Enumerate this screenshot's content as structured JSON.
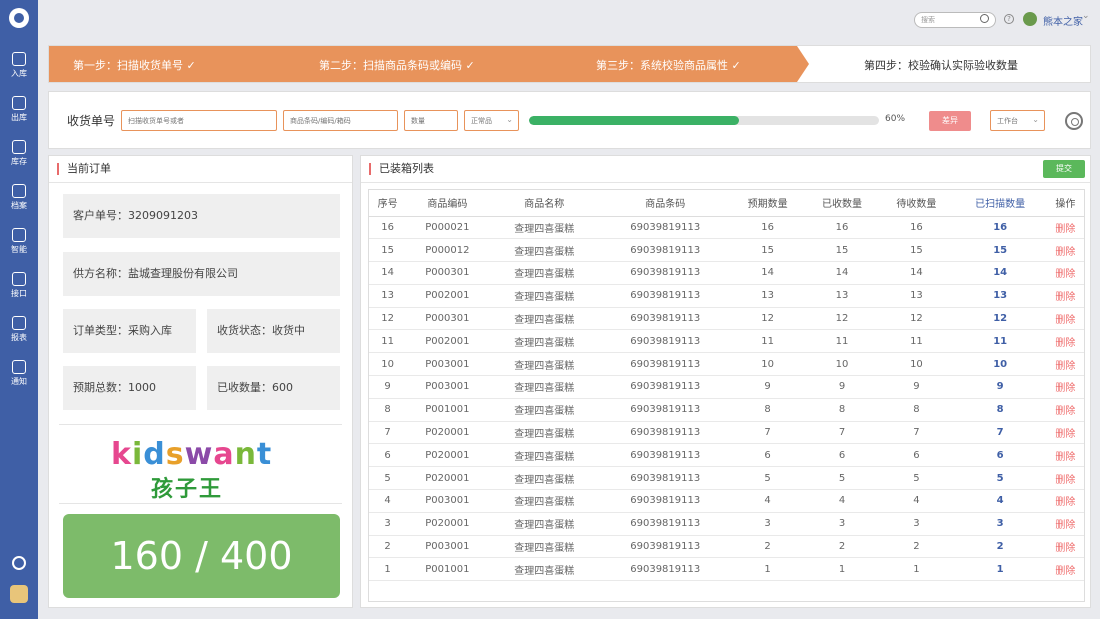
{
  "sidebar": {
    "items": [
      {
        "label": "入库",
        "icon": "home-icon"
      },
      {
        "label": "出库",
        "icon": "export-icon"
      },
      {
        "label": "库存",
        "icon": "warehouse-icon"
      },
      {
        "label": "档案",
        "icon": "archive-icon"
      },
      {
        "label": "智能",
        "icon": "smart-icon"
      },
      {
        "label": "接口",
        "icon": "api-icon"
      },
      {
        "label": "报表",
        "icon": "report-icon"
      },
      {
        "label": "通知",
        "icon": "bell-icon"
      }
    ]
  },
  "topbar": {
    "search_placeholder": "搜索",
    "user_name": "熊本之家"
  },
  "steps": {
    "step1": "第一步：扫描收货单号 ✓",
    "step2": "第二步：扫描商品条码或编码 ✓",
    "step3": "第三步：系统校验商品属性 ✓",
    "step4": "第四步：校验确认实际验收数量"
  },
  "inputbar": {
    "label": "收货单号",
    "order_placeholder": "扫描收货单号或者",
    "barcode_placeholder": "商品条码/编码/箱码",
    "qty_placeholder": "数量",
    "quality_value": "正常品",
    "progress_percent": 60,
    "progress_text": "60%",
    "diff_button": "差异",
    "station_value": "工作台"
  },
  "left_panel": {
    "title": "当前订单",
    "customer_no": "客户单号：3209091203",
    "supplier": "供方名称：盐城查理股份有限公司",
    "order_type": "订单类型：采购入库",
    "receive_status": "收货状态：收货中",
    "expected_total": "预期总数：1000",
    "received_qty": "已收数量：600",
    "logo_text_en": "kidswant",
    "logo_text_cn": "孩子王",
    "counter": "160 / 400"
  },
  "right_panel": {
    "title": "已装箱列表",
    "submit_button": "提交",
    "headers": [
      "序号",
      "商品编码",
      "商品名称",
      "商品条码",
      "预期数量",
      "已收数量",
      "待收数量",
      "已扫描数量",
      "操作"
    ],
    "rows": [
      [
        "16",
        "P000021",
        "查理四喜蛋糕",
        "69039819113",
        "16",
        "16",
        "16",
        "16",
        "删除"
      ],
      [
        "15",
        "P000012",
        "查理四喜蛋糕",
        "69039819113",
        "15",
        "15",
        "15",
        "15",
        "删除"
      ],
      [
        "14",
        "P000301",
        "查理四喜蛋糕",
        "69039819113",
        "14",
        "14",
        "14",
        "14",
        "删除"
      ],
      [
        "13",
        "P002001",
        "查理四喜蛋糕",
        "69039819113",
        "13",
        "13",
        "13",
        "13",
        "删除"
      ],
      [
        "12",
        "P000301",
        "查理四喜蛋糕",
        "69039819113",
        "12",
        "12",
        "12",
        "12",
        "删除"
      ],
      [
        "11",
        "P002001",
        "查理四喜蛋糕",
        "69039819113",
        "11",
        "11",
        "11",
        "11",
        "删除"
      ],
      [
        "10",
        "P003001",
        "查理四喜蛋糕",
        "69039819113",
        "10",
        "10",
        "10",
        "10",
        "删除"
      ],
      [
        "9",
        "P003001",
        "查理四喜蛋糕",
        "69039819113",
        "9",
        "9",
        "9",
        "9",
        "删除"
      ],
      [
        "8",
        "P001001",
        "查理四喜蛋糕",
        "69039819113",
        "8",
        "8",
        "8",
        "8",
        "删除"
      ],
      [
        "7",
        "P020001",
        "查理四喜蛋糕",
        "69039819113",
        "7",
        "7",
        "7",
        "7",
        "删除"
      ],
      [
        "6",
        "P020001",
        "查理四喜蛋糕",
        "69039819113",
        "6",
        "6",
        "6",
        "6",
        "删除"
      ],
      [
        "5",
        "P020001",
        "查理四喜蛋糕",
        "69039819113",
        "5",
        "5",
        "5",
        "5",
        "删除"
      ],
      [
        "4",
        "P003001",
        "查理四喜蛋糕",
        "69039819113",
        "4",
        "4",
        "4",
        "4",
        "删除"
      ],
      [
        "3",
        "P020001",
        "查理四喜蛋糕",
        "69039819113",
        "3",
        "3",
        "3",
        "3",
        "删除"
      ],
      [
        "2",
        "P003001",
        "查理四喜蛋糕",
        "69039819113",
        "2",
        "2",
        "2",
        "2",
        "删除"
      ],
      [
        "1",
        "P001001",
        "查理四喜蛋糕",
        "69039819113",
        "1",
        "1",
        "1",
        "1",
        "删除"
      ]
    ]
  },
  "colors": {
    "sidebar": "#3f5fa6",
    "step_orange": "#e8935b",
    "progress_green": "#3bb165",
    "diff_red": "#ef8c8c",
    "submit_green": "#5bb85b",
    "counter_green": "#7dbb6a",
    "scan_blue": "#3f5fa6",
    "delete_red": "#ef6b6b"
  }
}
